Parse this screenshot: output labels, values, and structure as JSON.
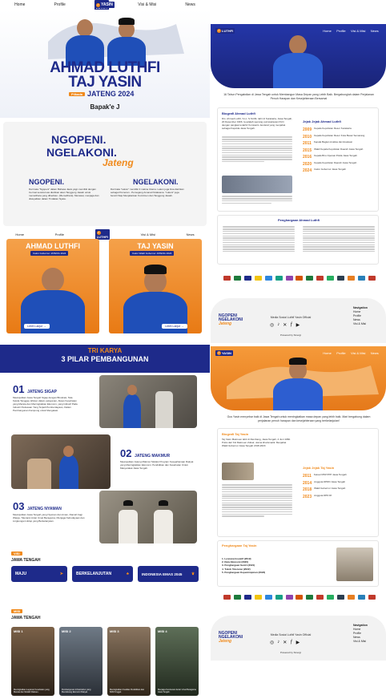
{
  "nav": {
    "home": "Home",
    "profile": "Profile",
    "visi_misi": "Visi & Misi",
    "news": "News"
  },
  "logo": {
    "line1": "LUTHFI",
    "line2": "YASIN"
  },
  "hero": {
    "name1": "AHMAD LUTHFI",
    "name2": "TAJ YASIN",
    "badge": "Pilkada",
    "sub": "JATENG 2024",
    "tagline": "Bapak'e J"
  },
  "motto": {
    "line1": "NGOPENI.",
    "line2": "NGELAKONI.",
    "script": "Jateng",
    "ngopeni_title": "NGOPENI.",
    "ngopeni_text": "Dari kata \"Ngopeni\" dalam Bahasa Jawa yagn memiliki dengan Cermat secara luas diartikan akan Tanggung Jawab untuk memelihara yang diberikan. (Memelihara). Merawat, menjaga dan diwujudkan dalam Tindakan Nyata.",
    "ngelakoni_title": "NGELAKONI.",
    "ngelakoni_text": "Dari kata \"Lakon\" memiliki 3 makna Utama. Lakon juga bisa diartikan sebagai Pemeran - Pemegang Amanat Pelaksana. \"Lakoni\" juga berarti Siap Menjalankan Komitmen dan Tanggung Jawab."
  },
  "cand": {
    "name1": "AHMAD LUTHFI",
    "role1": "Calon Gubernur JATENG 2024",
    "name2": "TAJ YASIN",
    "role2": "Calon Wakil Gubernur JATENG 2024",
    "more": "Lebih Lanjut"
  },
  "karya": {
    "title1": "TRI KARYA",
    "title2": "3 PILAR PEMBANGUNAN",
    "p1_num": "01",
    "p1_title": "JATENG SIGAP",
    "p1_text": "Mewujudkan Jawa Tengah Sigap dengan Birokrasi, Tata Kelola Tanggap, Efisien dalam pelayanan, Akses Kesehatan yang Merata dan Meningkatkan Ekonomi, yang Inklusif Pada Industri Pedesaan Yang Terjadi Pemberdayaan, Dalam Pembangunan Kampung untuk Mengatasi.",
    "p2_num": "02",
    "p2_title": "JATENG MAKMUR",
    "p2_text": "Mewujudkan Jateng Makmur Melalui Program Kesejahteraan Rakyat yang Meningkatkan Ekonomi, Pendidikan dan Kesehatan Untuk Masyarakat Jawa Tengah.",
    "p3_num": "03",
    "p3_title": "JATENG NYAMAN",
    "p3_text": "Mewujudkan Jawa Tengah yang Nyaman dan Aman, Ramah bagi Warga, Toleransi Antar Umat Beragama, Menjaga Kebudayaan dan Lingkungan Hidup yang Berkelanjutan."
  },
  "visi": {
    "tag": "VISI",
    "region": "JAWA TENGAH",
    "items": [
      "MAJU",
      "BERKELANJUTAN",
      "INDONESIA EMAS 2045"
    ]
  },
  "misi": {
    "tag": "MISI",
    "region": "JAWA TENGAH",
    "items": [
      {
        "label": "MISI 1",
        "text": "Meningkatkan Layanan Kesehatan yang Merata dan Mudah Diakses."
      },
      {
        "label": "MISI 2",
        "text": "Pembangunan Infrastruktur yang Mendukung Ekonomi Rakyat."
      },
      {
        "label": "MISI 3",
        "text": "Meningkatkan Kualitas Pendidikan dan SDM Unggul."
      },
      {
        "label": "MISI 4",
        "text": "Menjaga Kerukunan Antar Umat Beragama Jawa Tengah."
      }
    ]
  },
  "luthfi": {
    "intro": "16 Tahun Pengabdian di Jawa Tengah untuk Membangun Masa Depan yang Lebih Baik. Bergabunglah dalam Perjalanan Penuh Harapan dan Kesejahteraan Bersama!",
    "bio_title": "Biografi Ahmad Luthfi",
    "bio_text": "Drs. Ahmad Luthfi, S.H., S.St.Mk. lahir di Surakarta, Jawa Tengah, 20 Desember 1966. Ia adalah seorang purnawirawan Polri dengan pangkat terakhir Komisaris Jenderal yang menjabat sebagai Kapolda Jawa Tengah.",
    "jejak_title": "Jejak Jejak Ahmad Luthfi",
    "jejak": [
      {
        "y": "2009",
        "t": "Kepala Kepolisian Resor Surakarta"
      },
      {
        "y": "2010",
        "t": "Kepala Kepolisian Resor Kota Besar Semarang"
      },
      {
        "y": "2011",
        "t": "Kepala Bagian Analisa dan Evaluasi"
      },
      {
        "y": "2015",
        "t": "Wakil Kepala Kepolisian Daerah Jawa Tengah"
      },
      {
        "y": "2016",
        "t": "Kepala Biro Operasi Polda Jawa Tengah"
      },
      {
        "y": "2020",
        "t": "Kepala Kepolisian Daerah Jawa Tengah"
      },
      {
        "y": "2024",
        "t": "Calon Gubernur Jawa Tengah"
      }
    ],
    "award_title": "Penghargaan Ahmad Luthfi"
  },
  "yasin": {
    "intro": "Gus Yasin menyebar baik di Jawa Tengah untuk meningkatkan masa depan yang lebih baik. Mari bergabung dalam perjalanan penuh harapan dan kesejahteraan yang berkelanjutan!",
    "bio_title": "Biografi Taj Yasin",
    "bio_text": "Taj Yasin Maimoen lahir di Rembang, Jawa Tengah, 4 Juni 1982. Putra dari KH Maimoen Zubair, ulama kharismatik. Menjabat Wakil Gubernur Jawa Tengah 2018-2023.",
    "jejak_title": "Jejak Jejak Taj Yasin",
    "jejak": [
      {
        "y": "2011",
        "t": "Ketua DPW PPP Jawa Tengah"
      },
      {
        "y": "2014",
        "t": "Anggota DPRD Jawa Tengah"
      },
      {
        "y": "2018",
        "t": "Wakil Gubernur Jawa Tengah"
      },
      {
        "y": "2023",
        "t": "Anggota DPD RI"
      }
    ],
    "award_title": "Penghargaan Taj Yasin",
    "awards": [
      "1. Lencana Inovatif (2019)",
      "2. Duta Ekonomi (2020)",
      "3. Penghargaan Santri (2021)",
      "4. Tokoh Toleransi (2022)",
      "5. Penghargaan Kepemimpinan (2023)"
    ]
  },
  "footer": {
    "brand1": "NGOPENI",
    "brand2": "NGELAKONI",
    "brand3": "Jateng",
    "social": "Media Sosial Luthfi Yasin Official",
    "credit": "Powered by Sinergi",
    "nav_title": "Navigation"
  },
  "colors": {
    "navy": "#1e2a8a",
    "orange": "#f08a1c",
    "blue": "#1f4fb8"
  }
}
